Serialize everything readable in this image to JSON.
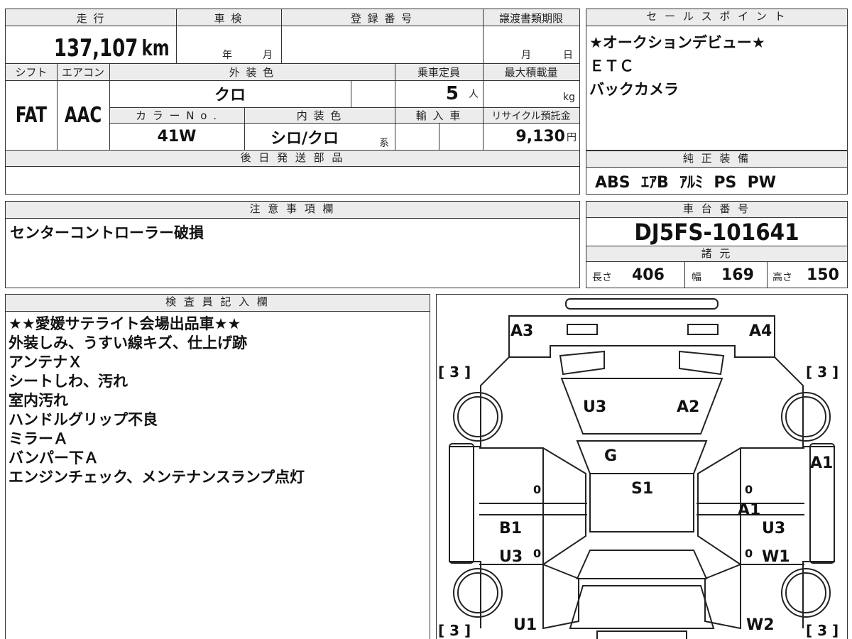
{
  "top": {
    "mileage_label": "走 行",
    "mileage_value": "137,107",
    "mileage_unit": "km",
    "inspection_label": "車 検",
    "inspection_year": "年",
    "inspection_month": "月",
    "reg_label": "登 録 番 号",
    "transfer_label": "譲渡書類期限",
    "transfer_month": "月",
    "transfer_day": "日"
  },
  "row2": {
    "shift_label": "シフト",
    "shift_value": "FAT",
    "ac_label": "エアコン",
    "ac_value": "AAC",
    "ext_color_label": "外 装 色",
    "ext_color_value": "クロ",
    "capacity_label": "乗車定員",
    "capacity_value": "5",
    "capacity_unit": "人",
    "max_load_label": "最大積載量",
    "max_load_unit": "kg",
    "color_no_label": "カ ラ ー N o .",
    "color_no_value": "41W",
    "int_color_label": "内 装 色",
    "int_color_value": "シロ/クロ",
    "int_color_suffix": "系",
    "import_label": "輸 入 車",
    "recycle_label": "リサイクル預託金",
    "recycle_value": "9,130",
    "recycle_unit": "円"
  },
  "later_parts_label": "後 日 発 送 部 品",
  "sales_points": {
    "header": "セ ー ル ス ポ イ ン ト",
    "lines": [
      "★オークションデビュー★",
      "ＥＴＣ",
      "バックカメラ"
    ]
  },
  "equipment": {
    "header": "純 正 装 備",
    "value": "ABS  ｴｱB  ｱﾙﾐ  PS  PW"
  },
  "notes": {
    "header": "注 意 事 項 欄",
    "text": "センターコントローラー破損"
  },
  "chassis": {
    "header": "車 台 番 号",
    "value": "DJ5FS-101641"
  },
  "specs": {
    "header": "諸 元",
    "length_label": "長さ",
    "length_value": "406",
    "width_label": "幅",
    "width_value": "169",
    "height_label": "高さ",
    "height_value": "150"
  },
  "inspector": {
    "header": "検 査 員 記 入 欄",
    "lines": [
      "★★愛媛サテライト会場出品車★★",
      "外装しみ、うすい線キズ、仕上げ跡",
      "アンテナＸ",
      "シートしわ、汚れ",
      "室内汚れ",
      "ハンドルグリップ不良",
      "ミラーＡ",
      "バンパー下Ａ",
      "エンジンチェック、メンテナンスランプ点灯"
    ]
  },
  "diagram": {
    "marks": {
      "a3": "A3",
      "a4": "A4",
      "u3_hood": "U3",
      "a2": "A2",
      "g": "G",
      "s1": "S1",
      "a1_right": "A1",
      "a1_door": "A1",
      "b1": "B1",
      "u3_left": "U3",
      "u3_right": "U3",
      "w1": "W1",
      "u1": "U1",
      "w2": "W2",
      "zero_1": "0",
      "zero_2": "0",
      "zero_3": "0",
      "zero_4": "0"
    },
    "tread": {
      "fl": "[ 3 ]",
      "fr": "[ 3 ]",
      "rl": "[ 3 ]",
      "rr": "[ 3 ]"
    }
  }
}
